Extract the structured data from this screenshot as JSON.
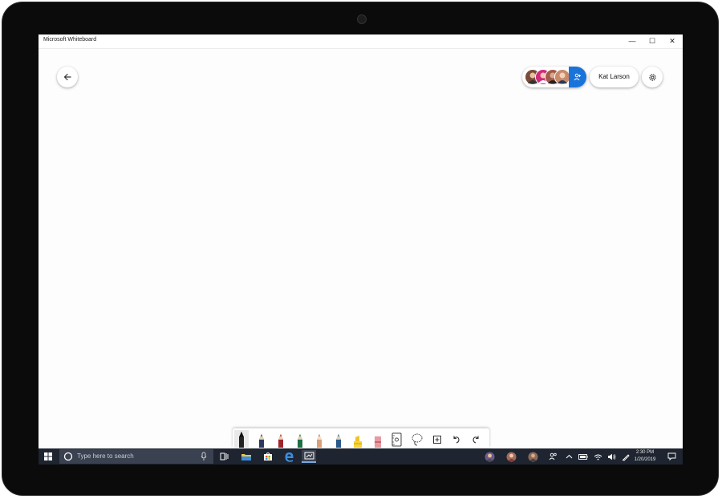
{
  "window": {
    "title": "Microsoft Whiteboard",
    "minimize_glyph": "—",
    "maximize_glyph": "☐",
    "close_glyph": "✕"
  },
  "header": {
    "back_icon": "back-arrow-icon",
    "user_name": "Kat Larson",
    "settings_icon": "gear-icon",
    "invite_icon": "add-person-icon",
    "collaborators": [
      {
        "color": "#7a4a3a"
      },
      {
        "color": "#d02a7c"
      },
      {
        "color": "#a35a4a"
      },
      {
        "color": "#c98a6a"
      }
    ]
  },
  "toolbar": {
    "tools": [
      {
        "name": "black-pen",
        "color": "#111111"
      },
      {
        "name": "blue-pen",
        "color": "#1a3fa6"
      },
      {
        "name": "red-pen",
        "color": "#c41f2c"
      },
      {
        "name": "green-pen",
        "color": "#1e8a52"
      },
      {
        "name": "pink-pen",
        "color": "#e06a6a"
      },
      {
        "name": "teal-pen",
        "color": "#2b76a8"
      },
      {
        "name": "yellow-highlighter",
        "color": "#f6d43b"
      },
      {
        "name": "eraser",
        "color": "#e89aa0"
      },
      {
        "name": "ruler",
        "color": "#555555"
      },
      {
        "name": "lasso-select",
        "color": "#555555"
      },
      {
        "name": "add-content",
        "color": "#444444"
      },
      {
        "name": "undo",
        "color": "#444444"
      },
      {
        "name": "redo",
        "color": "#444444"
      }
    ]
  },
  "taskbar": {
    "search_placeholder": "Type here to search",
    "time": "2:30 PM",
    "date": "1/20/2019",
    "accent": "#1e2430"
  }
}
